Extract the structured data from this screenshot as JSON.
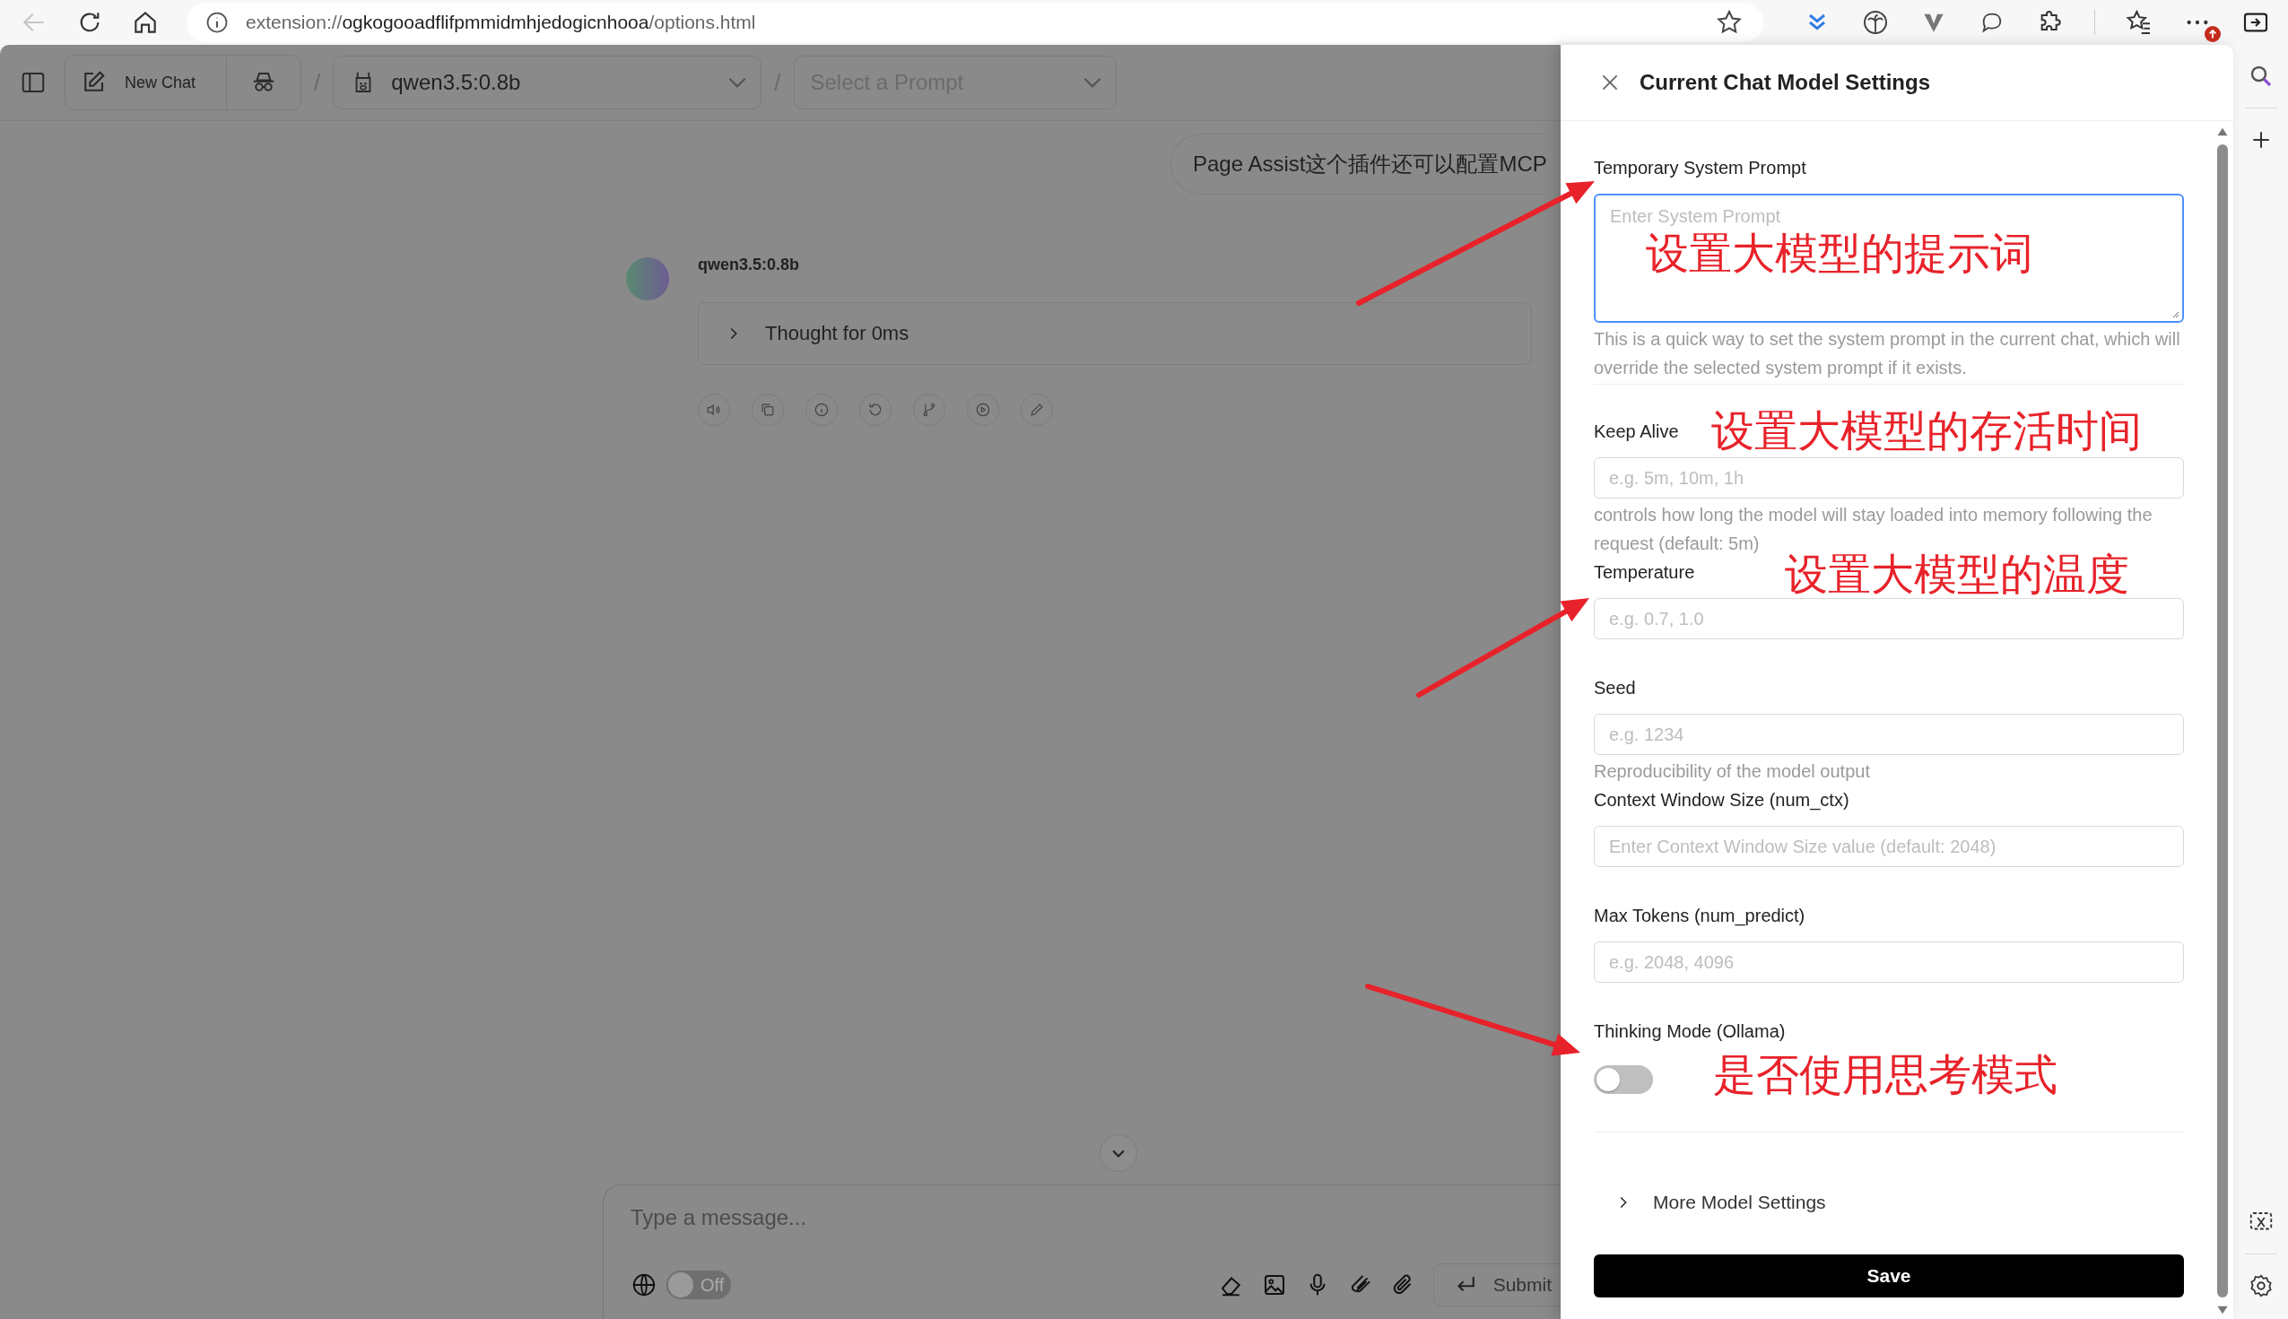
{
  "browser": {
    "back_disabled": true,
    "address": {
      "scheme": "extension://",
      "host": "ogkogooadflifpmmidmhjedogicnhooa",
      "path": "/options.html"
    },
    "menu_badge": true
  },
  "chat_header": {
    "new_chat": "New Chat",
    "separator": "/",
    "model": "qwen3.5:0.8b",
    "prompt_placeholder": "Select a Prompt"
  },
  "messages": [
    {
      "kind": "user",
      "text": "Page Assist这个插件还可以配置MCP"
    },
    {
      "kind": "assistant",
      "name": "qwen3.5:0.8b",
      "thought": "Thought for 0ms",
      "thought_expanded": false
    }
  ],
  "composer": {
    "placeholder": "Type a message...",
    "web_search": {
      "label": "Off",
      "on": false
    },
    "submit": "Submit"
  },
  "drawer": {
    "title": "Current Chat Model Settings",
    "fields": [
      {
        "kind": "textarea",
        "label": "Temporary System Prompt",
        "placeholder": "Enter System Prompt",
        "help": "This is a quick way to set the system prompt in the current chat, which will override the selected system prompt if it exists."
      },
      {
        "kind": "input",
        "label": "Keep Alive",
        "placeholder": "e.g. 5m, 10m, 1h",
        "help": "controls how long the model will stay loaded into memory following the request (default: 5m)"
      },
      {
        "kind": "input",
        "label": "Temperature",
        "placeholder": "e.g. 0.7, 1.0"
      },
      {
        "kind": "input",
        "label": "Seed",
        "placeholder": "e.g. 1234",
        "help": "Reproducibility of the model output"
      },
      {
        "kind": "input",
        "label": "Context Window Size (num_ctx)",
        "placeholder": "Enter Context Window Size value (default: 2048)"
      },
      {
        "kind": "input",
        "label": "Max Tokens (num_predict)",
        "placeholder": "e.g. 2048, 4096"
      },
      {
        "kind": "switch",
        "label": "Thinking Mode (Ollama)",
        "on": false
      }
    ],
    "more": {
      "label": "More Model Settings",
      "expanded": false
    },
    "save": "Save"
  },
  "annotations": [
    {
      "text": "设置大模型的提示词"
    },
    {
      "text": "设置大模型的存活时间"
    },
    {
      "text": "设置大模型的温度"
    },
    {
      "text": "是否使用思考模式"
    }
  ]
}
